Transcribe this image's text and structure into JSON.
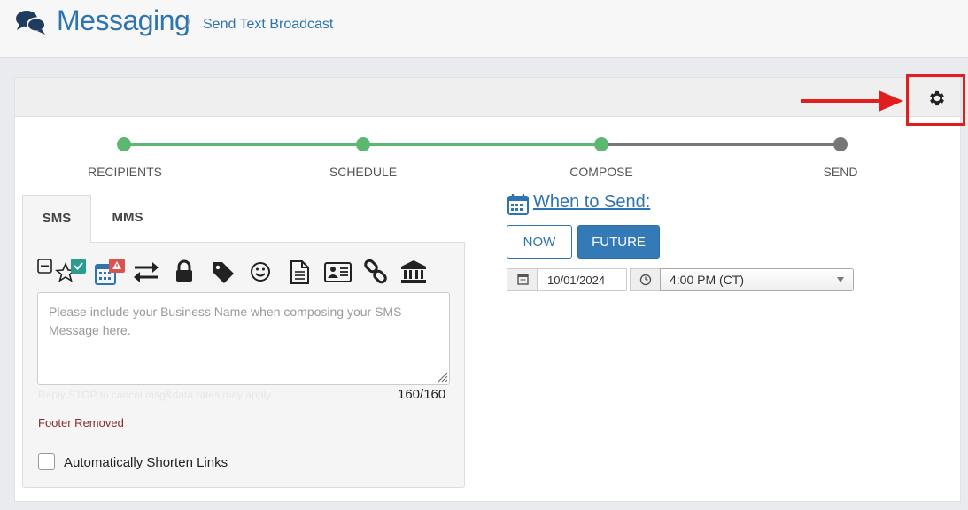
{
  "header": {
    "title": "Messaging",
    "breadcrumb_separator": "/",
    "breadcrumb": "Send Text Broadcast"
  },
  "steps": [
    {
      "label": "RECIPIENTS",
      "done": true
    },
    {
      "label": "SCHEDULE",
      "done": true
    },
    {
      "label": "COMPOSE",
      "done": true
    },
    {
      "label": "SEND",
      "done": false
    }
  ],
  "tabs": [
    {
      "label": "SMS",
      "active": true
    },
    {
      "label": "MMS",
      "active": false
    }
  ],
  "toolbar_icons": [
    "collapse-icon",
    "star-check-icon",
    "calendar-alert-icon",
    "swap-arrows-icon",
    "lock-icon",
    "tag-icon",
    "smiley-icon",
    "document-icon",
    "contact-card-icon",
    "link-icon",
    "bank-icon"
  ],
  "composer": {
    "placeholder": "Please include your Business Name when composing your SMS Message here.",
    "value": "",
    "footer_hint": "Reply STOP to cancel msg&data rates may apply",
    "counter": "160/160",
    "footer_status": "Footer Removed",
    "shorten_links_label": "Automatically Shorten Links",
    "shorten_links_checked": false
  },
  "schedule": {
    "title": "When to Send:",
    "now_label": "NOW",
    "future_label": "FUTURE",
    "selected": "FUTURE",
    "date": "10/01/2024",
    "time": "4:00 PM (CT)"
  },
  "colors": {
    "accent": "#2e74b0",
    "step_done": "#5cb870",
    "step_pending": "#777777",
    "highlight": "#e01e1e",
    "footer_status": "#8b2a2a"
  }
}
